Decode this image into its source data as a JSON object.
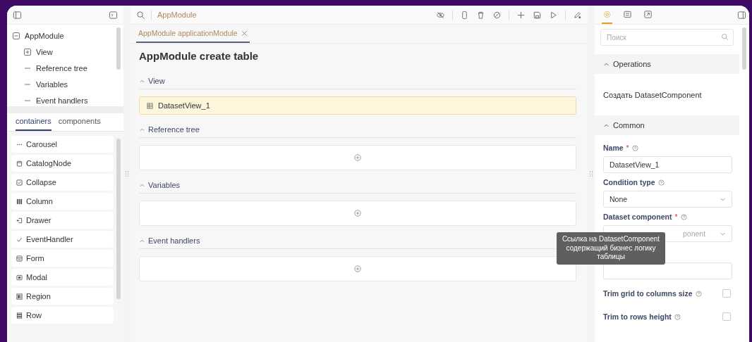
{
  "search_bar": {
    "text": "AppModule"
  },
  "tree": [
    {
      "label": "AppModule",
      "kind": "expandable",
      "expanded": true,
      "children": [
        {
          "label": "View",
          "kind": "expandable",
          "expanded": false
        },
        {
          "label": "Reference tree",
          "kind": "leaf"
        },
        {
          "label": "Variables",
          "kind": "leaf"
        },
        {
          "label": "Event handlers",
          "kind": "leaf"
        }
      ]
    }
  ],
  "palette_tabs": [
    {
      "label": "containers",
      "selected": true
    },
    {
      "label": "components",
      "selected": false
    }
  ],
  "palette_items": [
    {
      "label": "Carousel",
      "kind": "dots"
    },
    {
      "label": "CatalogNode",
      "kind": "node"
    },
    {
      "label": "Collapse",
      "kind": "check-square"
    },
    {
      "label": "Column",
      "kind": "columns"
    },
    {
      "label": "Drawer",
      "kind": "drawer"
    },
    {
      "label": "EventHandler",
      "kind": "tick"
    },
    {
      "label": "Form",
      "kind": "form"
    },
    {
      "label": "Modal",
      "kind": "modal"
    },
    {
      "label": "Region",
      "kind": "region"
    },
    {
      "label": "Row",
      "kind": "rows"
    }
  ],
  "editor_tabs": [
    {
      "label": "AppModule applicationModule",
      "selected": true
    }
  ],
  "page_title": "AppModule create table",
  "sections": [
    {
      "title": "View",
      "expanded": true,
      "items": [
        {
          "label": "DatasetView_1",
          "selected": true
        }
      ]
    },
    {
      "title": "Reference tree",
      "expanded": true
    },
    {
      "title": "Variables",
      "expanded": true
    },
    {
      "title": "Event handlers",
      "expanded": true
    }
  ],
  "right_tabs": [
    {
      "kind": "settings",
      "selected": true
    },
    {
      "kind": "list",
      "selected": false
    },
    {
      "kind": "export",
      "selected": false
    }
  ],
  "properties": {
    "search": {
      "placeholder": "Поиск"
    },
    "groups": [
      {
        "title": "Operations",
        "expanded": true,
        "actions": [
          "Создать DatasetComponent"
        ]
      },
      {
        "title": "Common",
        "expanded": true,
        "fields": [
          {
            "kind": "text",
            "label": "Name",
            "required_mark": "*",
            "value": "DatasetView_1"
          },
          {
            "kind": "select",
            "label": "Condition type",
            "value": "None"
          },
          {
            "kind": "select",
            "label": "Dataset component",
            "required_mark": "*",
            "placeholder": "ponent",
            "tooltip": "Ссылка на DatasetComponent содержащий бизнес логику таблицы"
          },
          {
            "kind": "text"
          },
          {
            "kind": "checkbox",
            "label": "Trim grid to columns size",
            "checked": false
          },
          {
            "kind": "checkbox",
            "label": "Trim to rows height",
            "checked": false
          }
        ]
      }
    ]
  }
}
